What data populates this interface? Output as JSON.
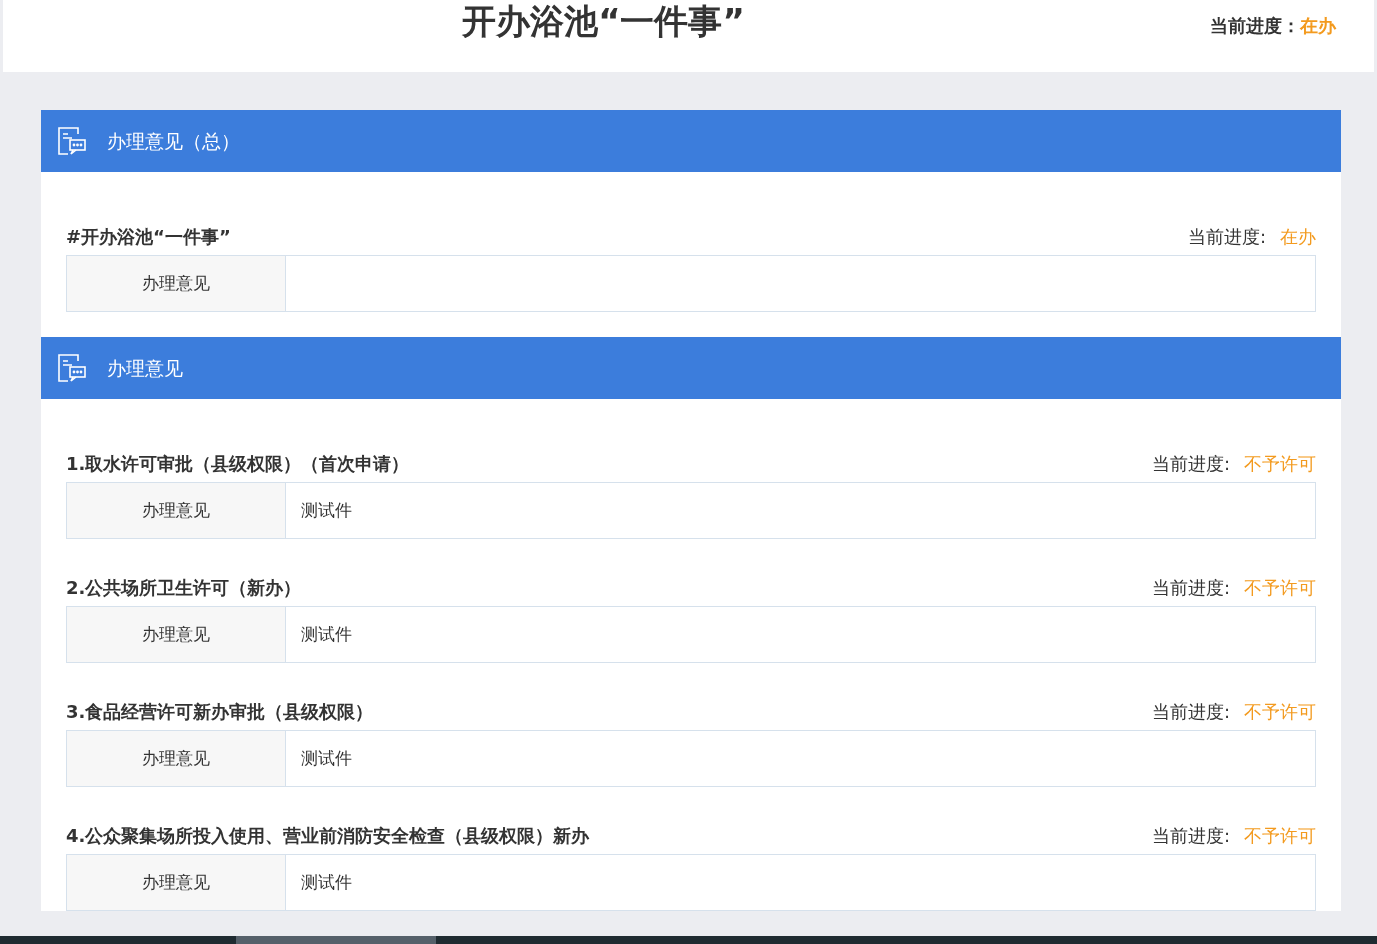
{
  "header": {
    "title": "开办浴池“一件事”",
    "progress_label": "当前进度：",
    "progress_value": "在办"
  },
  "sections": [
    {
      "title": "办理意见（总）",
      "items": [
        {
          "name": "#开办浴池“一件事”",
          "progress_label": "当前进度:",
          "progress_value": "在办",
          "field_label": "办理意见"
        }
      ]
    },
    {
      "title": "办理意见",
      "items": [
        {
          "name": "1.取水许可审批（县级权限）（首次申请）",
          "progress_label": "当前进度:",
          "progress_value": "不予许可",
          "field_label": "办理意见",
          "field_value": "测试件"
        },
        {
          "name": "2.公共场所卫生许可（新办）",
          "progress_label": "当前进度:",
          "progress_value": "不予许可",
          "field_label": "办理意见",
          "field_value": "测试件"
        },
        {
          "name": "3.食品经营许可新办审批（县级权限）",
          "progress_label": "当前进度:",
          "progress_value": "不予许可",
          "field_label": "办理意见",
          "field_value": "测试件"
        },
        {
          "name": "4.公众聚集场所投入使用、营业前消防安全检查（县级权限）新办",
          "progress_label": "当前进度:",
          "progress_value": "不予许可",
          "field_label": "办理意见",
          "field_value": "测试件"
        }
      ]
    }
  ]
}
